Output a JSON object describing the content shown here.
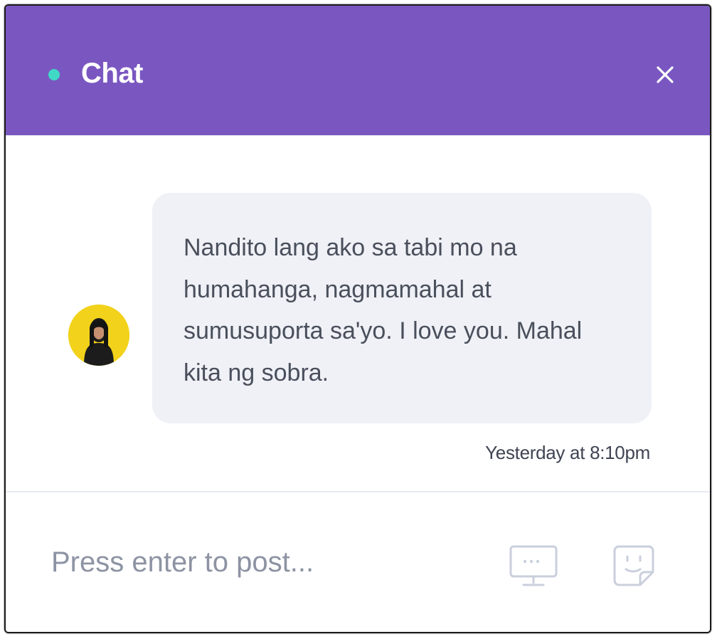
{
  "header": {
    "title": "Chat",
    "status_icon": "online-dot-icon",
    "close_icon": "close-icon",
    "color": "#7a57c0",
    "status_color": "#3fd9c6"
  },
  "messages": [
    {
      "avatar_icon": "user-avatar",
      "text": "Nandito lang ako sa tabi mo na humahanga, nagmamahal at sumusuporta sa'yo. I love you. Mahal kita ng sobra.",
      "timestamp": "Yesterday at 8:10pm",
      "bubble_color": "#eff1f6"
    }
  ],
  "composer": {
    "placeholder": "Press enter to post...",
    "value": "",
    "screen_icon": "screen-share-icon",
    "sticker_icon": "sticker-icon"
  }
}
